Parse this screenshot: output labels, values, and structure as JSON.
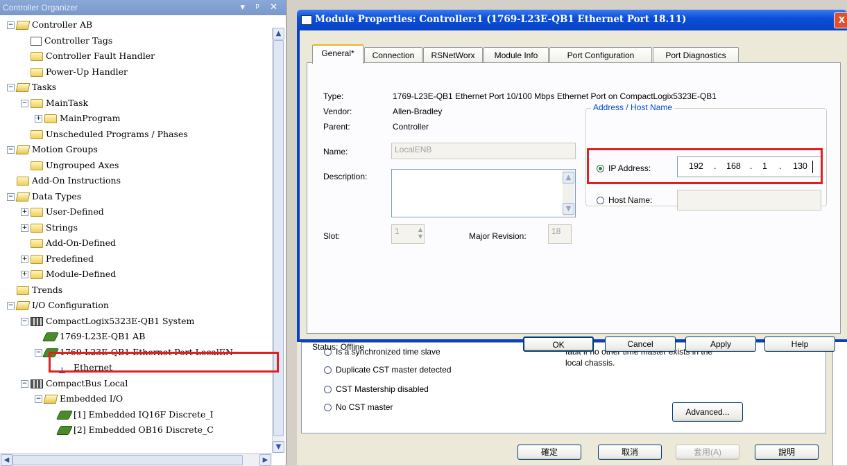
{
  "organizer": {
    "title": "Controller Organizer",
    "title_buttons": "▾ ᵖ ✕",
    "tree": [
      {
        "label": "Controller AB",
        "depth": 0,
        "toggle": "−",
        "icon": "folder-open-icon"
      },
      {
        "label": "Controller Tags",
        "depth": 1,
        "toggle": "",
        "icon": "tags-icon"
      },
      {
        "label": "Controller Fault Handler",
        "depth": 1,
        "toggle": "",
        "icon": "folder-icon"
      },
      {
        "label": "Power-Up Handler",
        "depth": 1,
        "toggle": "",
        "icon": "folder-icon"
      },
      {
        "label": "Tasks",
        "depth": 0,
        "toggle": "−",
        "icon": "folder-open-icon"
      },
      {
        "label": "MainTask",
        "depth": 1,
        "toggle": "−",
        "icon": "task-icon"
      },
      {
        "label": "MainProgram",
        "depth": 2,
        "toggle": "+",
        "icon": "program-icon"
      },
      {
        "label": "Unscheduled Programs / Phases",
        "depth": 1,
        "toggle": "",
        "icon": "folder-icon"
      },
      {
        "label": "Motion Groups",
        "depth": 0,
        "toggle": "−",
        "icon": "folder-open-icon"
      },
      {
        "label": "Ungrouped Axes",
        "depth": 1,
        "toggle": "",
        "icon": "folder-icon"
      },
      {
        "label": "Add-On Instructions",
        "depth": 0,
        "toggle": "",
        "icon": "folder-icon"
      },
      {
        "label": "Data Types",
        "depth": 0,
        "toggle": "−",
        "icon": "folder-open-icon"
      },
      {
        "label": "User-Defined",
        "depth": 1,
        "toggle": "+",
        "icon": "datatype-folder-icon"
      },
      {
        "label": "Strings",
        "depth": 1,
        "toggle": "+",
        "icon": "datatype-folder-icon"
      },
      {
        "label": "Add-On-Defined",
        "depth": 1,
        "toggle": "",
        "icon": "datatype-folder-icon"
      },
      {
        "label": "Predefined",
        "depth": 1,
        "toggle": "+",
        "icon": "datatype-folder-icon"
      },
      {
        "label": "Module-Defined",
        "depth": 1,
        "toggle": "+",
        "icon": "datatype-folder-icon"
      },
      {
        "label": "Trends",
        "depth": 0,
        "toggle": "",
        "icon": "folder-icon"
      },
      {
        "label": "I/O Configuration",
        "depth": 0,
        "toggle": "−",
        "icon": "folder-open-icon"
      },
      {
        "label": "CompactLogix5323E-QB1 System",
        "depth": 1,
        "toggle": "−",
        "icon": "rack-icon"
      },
      {
        "label": "1769-L23E-QB1 AB",
        "depth": 2,
        "toggle": "",
        "icon": "controller-icon"
      },
      {
        "label": "1769-L23E-QB1 Ethernet Port LocalEN",
        "depth": 2,
        "toggle": "−",
        "icon": "module-icon"
      },
      {
        "label": "Ethernet",
        "depth": 3,
        "toggle": "",
        "icon": "network-icon"
      },
      {
        "label": "CompactBus Local",
        "depth": 1,
        "toggle": "−",
        "icon": "bus-icon"
      },
      {
        "label": "Embedded I/O",
        "depth": 2,
        "toggle": "−",
        "icon": "folder-open-icon"
      },
      {
        "label": "[1] Embedded IQ16F Discrete_I",
        "depth": 3,
        "toggle": "",
        "icon": "module-icon"
      },
      {
        "label": "[2] Embedded OB16 Discrete_C",
        "depth": 3,
        "toggle": "",
        "icon": "module-icon"
      }
    ]
  },
  "back_dialog": {
    "options": [
      "Is a synchronized time slave",
      "Duplicate CST master detected",
      "CST Mastership disabled",
      "No CST master"
    ],
    "note_line1": "fault if no other time master exists in the",
    "note_line2": "local chassis.",
    "advanced_label": "Advanced...",
    "ok_label": "確定",
    "cancel_label": "取消",
    "apply_label": "套用(A)",
    "help_label": "說明"
  },
  "dialog": {
    "title": "Module Properties: Controller:1 (1769-L23E-QB1 Ethernet Port 18.11)",
    "close_label": "X",
    "tabs": [
      "General*",
      "Connection",
      "RSNetWorx",
      "Module Info",
      "Port Configuration",
      "Port Diagnostics"
    ],
    "type_label": "Type:",
    "type_value": "1769-L23E-QB1 Ethernet Port 10/100 Mbps Ethernet Port on CompactLogix5323E-QB1",
    "vendor_label": "Vendor:",
    "vendor_value": "Allen-Bradley",
    "parent_label": "Parent:",
    "parent_value": "Controller",
    "name_label": "Name:",
    "name_value": "LocalENB",
    "description_label": "Description:",
    "slot_label": "Slot:",
    "slot_value": "1",
    "major_revision_label": "Major Revision:",
    "major_revision_value": "18",
    "address_group_title": "Address / Host Name",
    "ip_label": "IP Address:",
    "ip": [
      "192",
      ".",
      "168",
      ".",
      "1",
      ".",
      "130"
    ],
    "host_label": "Host Name:",
    "status_text": "Status:  Offline",
    "ok_label": "OK",
    "cancel_label": "Cancel",
    "apply_label": "Apply",
    "help_label": "Help"
  }
}
